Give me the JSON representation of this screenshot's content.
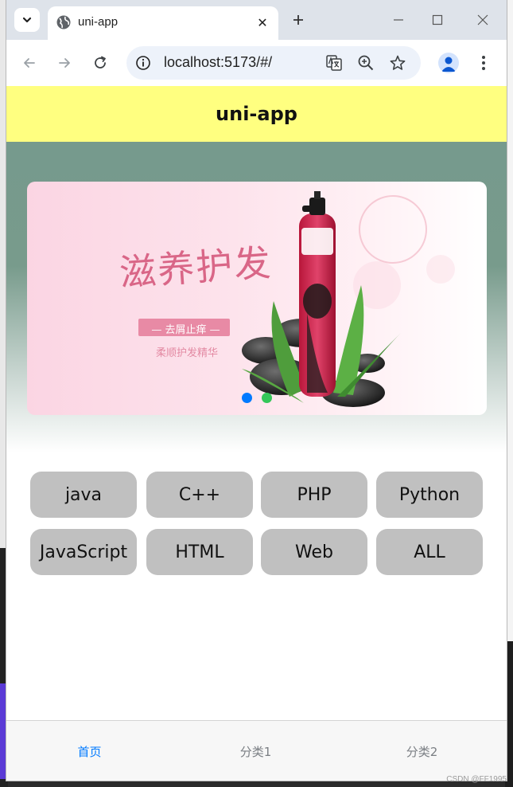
{
  "browser": {
    "tab_title": "uni-app",
    "url": "localhost:5173/#/"
  },
  "page": {
    "navbar_title": "uni-app",
    "banner": {
      "calligraphy": "滋养护发",
      "ribbon": "— 去屑止痒 —",
      "tagline": "柔顺护发精华",
      "active_index": 0,
      "count": 2
    },
    "categories": [
      "java",
      "C++",
      "PHP",
      "Python",
      "JavaScript",
      "HTML",
      "Web",
      "ALL"
    ],
    "tabbar": {
      "items": [
        "首页",
        "分类1",
        "分类2"
      ],
      "active_index": 0
    }
  },
  "watermark": "CSDN @FF1995",
  "colors": {
    "navbar_bg": "#ffff80",
    "hero_top": "#769a8d",
    "button_bg": "#c0c0c0",
    "tab_active": "#007aff",
    "tab_inactive": "#7a7e83",
    "dot_active": "#007aff",
    "dot_inactive": "#34c759"
  }
}
